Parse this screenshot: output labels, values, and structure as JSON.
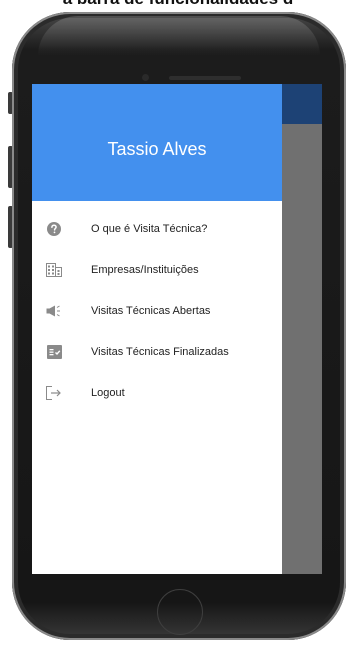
{
  "caption": "a barra de funcionalidades d",
  "drawer": {
    "user_name": "Tassio Alves",
    "header_color": "#4390EE",
    "items": [
      {
        "label": "O que é Visita Técnica?",
        "icon": "help-circle-icon"
      },
      {
        "label": "Empresas/Instituições",
        "icon": "building-icon"
      },
      {
        "label": "Visitas Técnicas Abertas",
        "icon": "megaphone-icon"
      },
      {
        "label": "Visitas Técnicas Finalizadas",
        "icon": "checklist-icon"
      },
      {
        "label": "Logout",
        "icon": "logout-icon"
      }
    ]
  },
  "colors": {
    "app_bar": "#1D4275",
    "scrim": "#707070",
    "icon": "#8A8A8A"
  }
}
